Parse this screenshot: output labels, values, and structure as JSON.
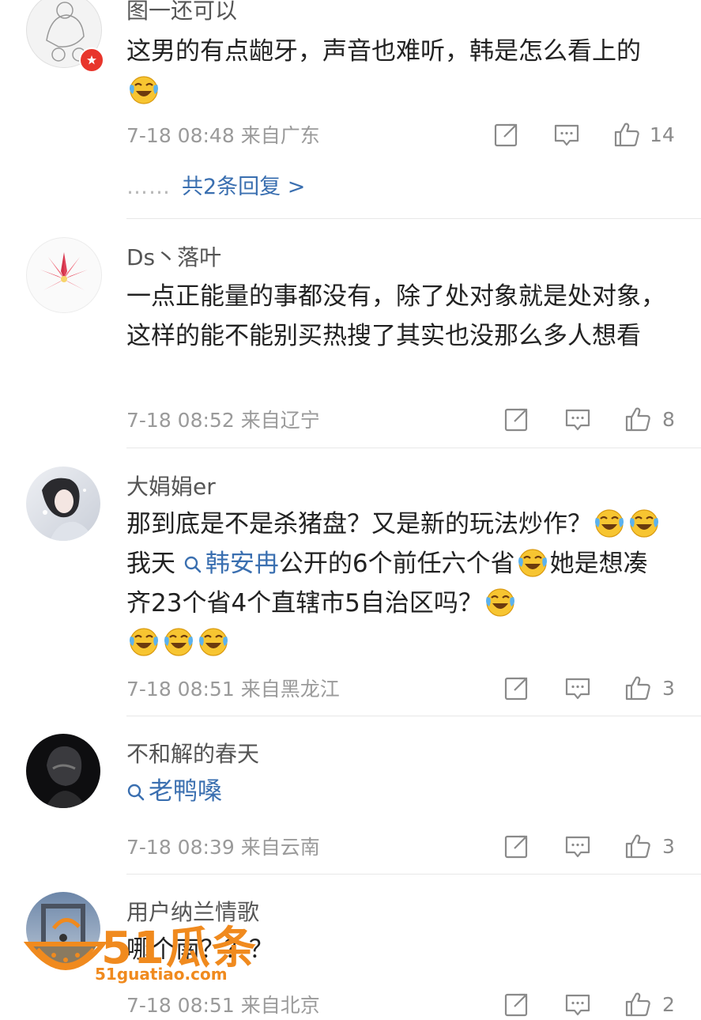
{
  "comments": [
    {
      "username": "图一还可以",
      "text_parts": [
        "这男的有点龅牙，声音也难听，韩是怎么看上的"
      ],
      "time": "7-18 08:48",
      "location": "来自广东",
      "likes": "14",
      "replies": "共2条回复 >"
    },
    {
      "username": "Ds丶落叶",
      "text_parts": [
        "一点正能量的事都没有，除了处对象就是处对象，这样的能不能别买热搜了其实也没那么多人想看"
      ],
      "time": "7-18 08:52",
      "location": "来自辽宁",
      "likes": "8"
    },
    {
      "username": "大娟娟er",
      "text_parts": [
        "那到底是不是杀猪盘？又是新的玩法炒作？",
        "我天",
        "韩安冉",
        "公开的6个前任六个省",
        "她是想凑齐23个省4个直辖市5自治区吗？"
      ],
      "time": "7-18 08:51",
      "location": "来自黑龙江",
      "likes": "3"
    },
    {
      "username": "不和解的春天",
      "text_parts": [
        "老鸭嗓"
      ],
      "time": "7-18 08:39",
      "location": "来自云南",
      "likes": "3"
    },
    {
      "username": "用户纳兰情歌",
      "text_parts": [
        "哪个南？？？"
      ],
      "time": "7-18 08:51",
      "location": "来自北京",
      "likes": "2"
    }
  ],
  "watermark": {
    "main": "51瓜条",
    "sub": "51guatiao.com"
  },
  "icons": [
    "share-icon",
    "comment-icon",
    "like-icon",
    "laugh-cry-emoji",
    "search-icon"
  ],
  "colors": {
    "link": "#3a6fb0",
    "meta": "#9a9a9a",
    "divider": "#e8e8e8",
    "watermark": "#f08a1e"
  }
}
